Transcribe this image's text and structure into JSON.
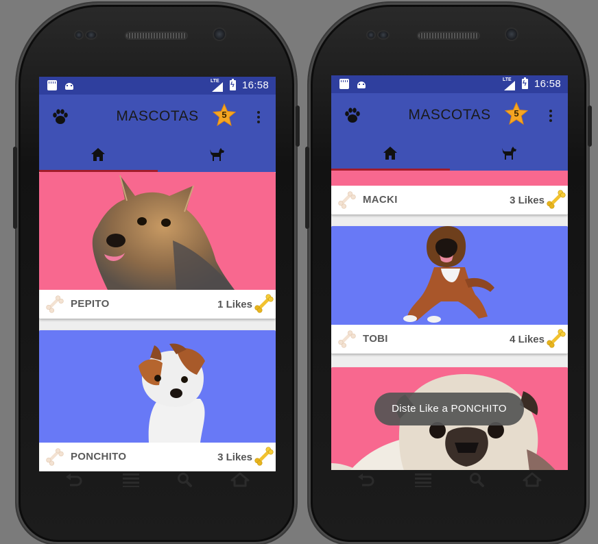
{
  "colors": {
    "primary": "#3f51b5",
    "status_bar": "#2f3f9e",
    "tab_indicator": "#a31c2a",
    "card_pink": "#f8688f",
    "card_blue": "#6879f6",
    "star": "#f5a623"
  },
  "status_bar": {
    "lte_label": "LTE",
    "time": "16:58",
    "icons": [
      "sd-card-icon",
      "android-icon",
      "signal-icon",
      "battery-charging-icon"
    ]
  },
  "toolbar": {
    "title": "MASCOTAS",
    "star_count": "5",
    "icons": [
      "paw-icon",
      "star-icon",
      "overflow-menu-icon"
    ]
  },
  "tabs": [
    {
      "icon": "home-icon",
      "selected": true
    },
    {
      "icon": "dog-icon",
      "selected": false
    }
  ],
  "left_screen": {
    "cards": [
      {
        "name": "PEPITO",
        "likes": "1 Likes",
        "background": "pink",
        "image": "yorkshire-terrier-photo"
      },
      {
        "name": "PONCHITO",
        "likes": "3 Likes",
        "background": "blue",
        "image": "jack-russell-terrier-photo"
      }
    ]
  },
  "right_screen": {
    "cards": [
      {
        "name": "MACKI",
        "likes": "3 Likes",
        "background": "pink"
      },
      {
        "name": "TOBI",
        "likes": "4 Likes",
        "background": "blue",
        "image": "boxer-dog-photo"
      },
      {
        "name": "",
        "likes": "",
        "background": "pink",
        "image": "pug-photo"
      }
    ],
    "toast": "Diste Like a PONCHITO"
  },
  "nav_buttons": [
    "back-icon",
    "menu-icon",
    "search-icon",
    "home-outline-icon"
  ]
}
